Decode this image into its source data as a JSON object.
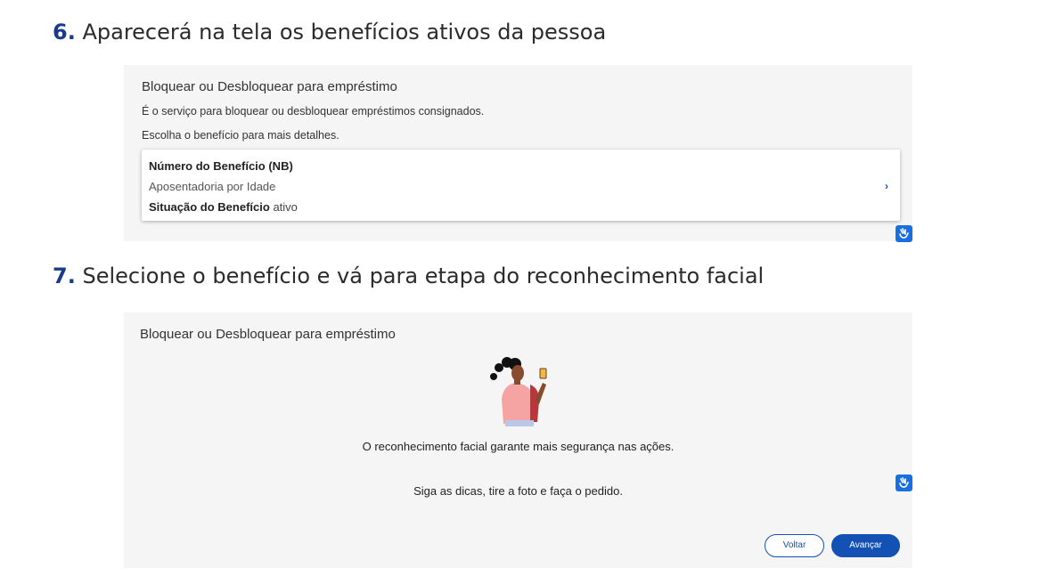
{
  "step6": {
    "number": "6.",
    "text": "Aparecerá na tela os benefícios ativos da pessoa"
  },
  "panel1": {
    "title": "Bloquear ou Desbloquear para empréstimo",
    "description": "É o serviço para bloquear ou desbloquear empréstimos consignados.",
    "instruction": "Escolha o benefício para mais detalhes.",
    "benefit_card": {
      "nb_label": "Número do Benefício (NB)",
      "type": "Aposentadoria por Idade",
      "status_label": "Situação do Benefício",
      "status_value": "ativo",
      "chevron": "›"
    }
  },
  "step7": {
    "number": "7.",
    "text": "Selecione o benefício e vá para etapa do reconhecimento facial"
  },
  "panel2": {
    "title": "Bloquear ou Desbloquear para empréstimo",
    "message": "O reconhecimento facial garante mais segurança nas ações.",
    "tip": "Siga as dicas, tire a foto e faça o pedido.",
    "back_label": "Voltar",
    "next_label": "Avançar"
  },
  "icons": {
    "accessibility": "vlibras-hand-icon",
    "illustration": "woman-selfie-illustration"
  },
  "colors": {
    "accent": "#1351b4",
    "step_number": "#1b3a8a",
    "panel_bg": "#f5f5f5",
    "vlibras": "#1a6fe0"
  }
}
